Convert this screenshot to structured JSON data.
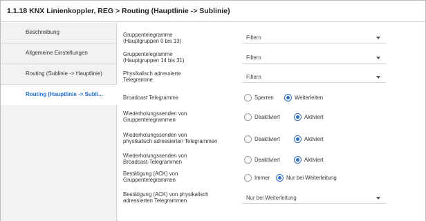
{
  "window": {
    "title": "1.1.18 KNX Linienkoppler, REG > Routing (Hauptlinie -> Sublinie)"
  },
  "sidebar": {
    "items": [
      {
        "label": "Beschreibung",
        "active": false
      },
      {
        "label": "Allgemeine Einstellungen",
        "active": false
      },
      {
        "label": "Routing (Sublinie -> Hauptlinie)",
        "active": false
      },
      {
        "label": "Routing (Hauptlinie -> Subli...",
        "active": true
      }
    ]
  },
  "params": {
    "p1": {
      "label": "Gruppentelegramme\n(Hauptgruppen 0 bis 13)",
      "value": "Filtern"
    },
    "p2": {
      "label": "Gruppentelegramme\n(Hauptgruppen 14 bis 31)",
      "value": "Filtern"
    },
    "p3": {
      "label": "Physikalisch adressierte\nTelegramme",
      "value": "Filtern"
    },
    "p4": {
      "label": "Broadcast Telegramme",
      "options": [
        "Sperren",
        "Weiterleiten"
      ],
      "selected": 1
    },
    "p5": {
      "label": "Wiederholungssenden von\nGruppentelegrammen",
      "options": [
        "Deaktiviert",
        "Aktiviert"
      ],
      "selected": 1
    },
    "p6": {
      "label": "Wiederholungssenden von\nphysikalisch adressierten Telegrammen",
      "options": [
        "Deaktiviert",
        "Aktiviert"
      ],
      "selected": 1
    },
    "p7": {
      "label": "Wiederholungssenden von\nBroadcast-Telegrammen",
      "options": [
        "Deaktiviert",
        "Aktiviert"
      ],
      "selected": 1
    },
    "p8": {
      "label": "Bestätigung (ACK) von\nGruppentelegrammen",
      "options": [
        "Immer",
        "Nur bei Weiterleitung"
      ],
      "selected": 1
    },
    "p9": {
      "label": "Bestätigung (ACK) von physikalisch\nadressierten Telegrammen",
      "value": "Nur bei Weiterleitung"
    }
  },
  "colors": {
    "accent": "#1f6fd1",
    "radio_selected": "#2b6fc6",
    "sidebar_bg": "#f2f2f2"
  }
}
